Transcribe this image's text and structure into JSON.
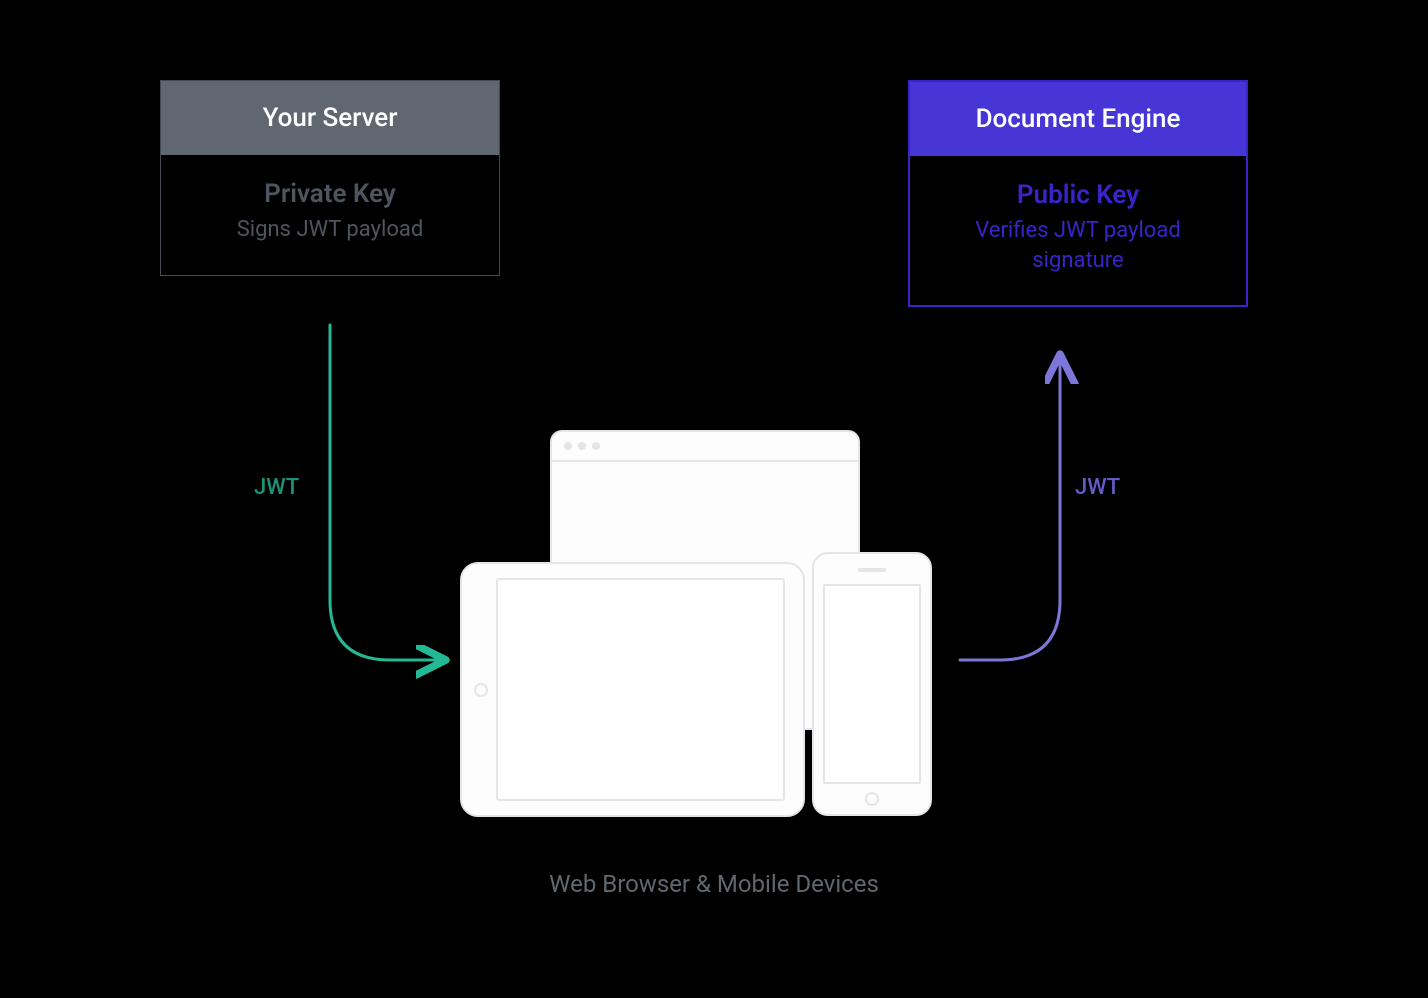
{
  "server": {
    "title": "Your Server",
    "key_label": "Private Key",
    "key_desc": "Signs JWT payload"
  },
  "engine": {
    "title": "Document Engine",
    "key_label": "Public Key",
    "key_desc": "Verifies JWT payload signature"
  },
  "arrows": {
    "left_label": "JWT",
    "right_label": "JWT"
  },
  "devices": {
    "caption": "Web Browser & Mobile Devices"
  }
}
